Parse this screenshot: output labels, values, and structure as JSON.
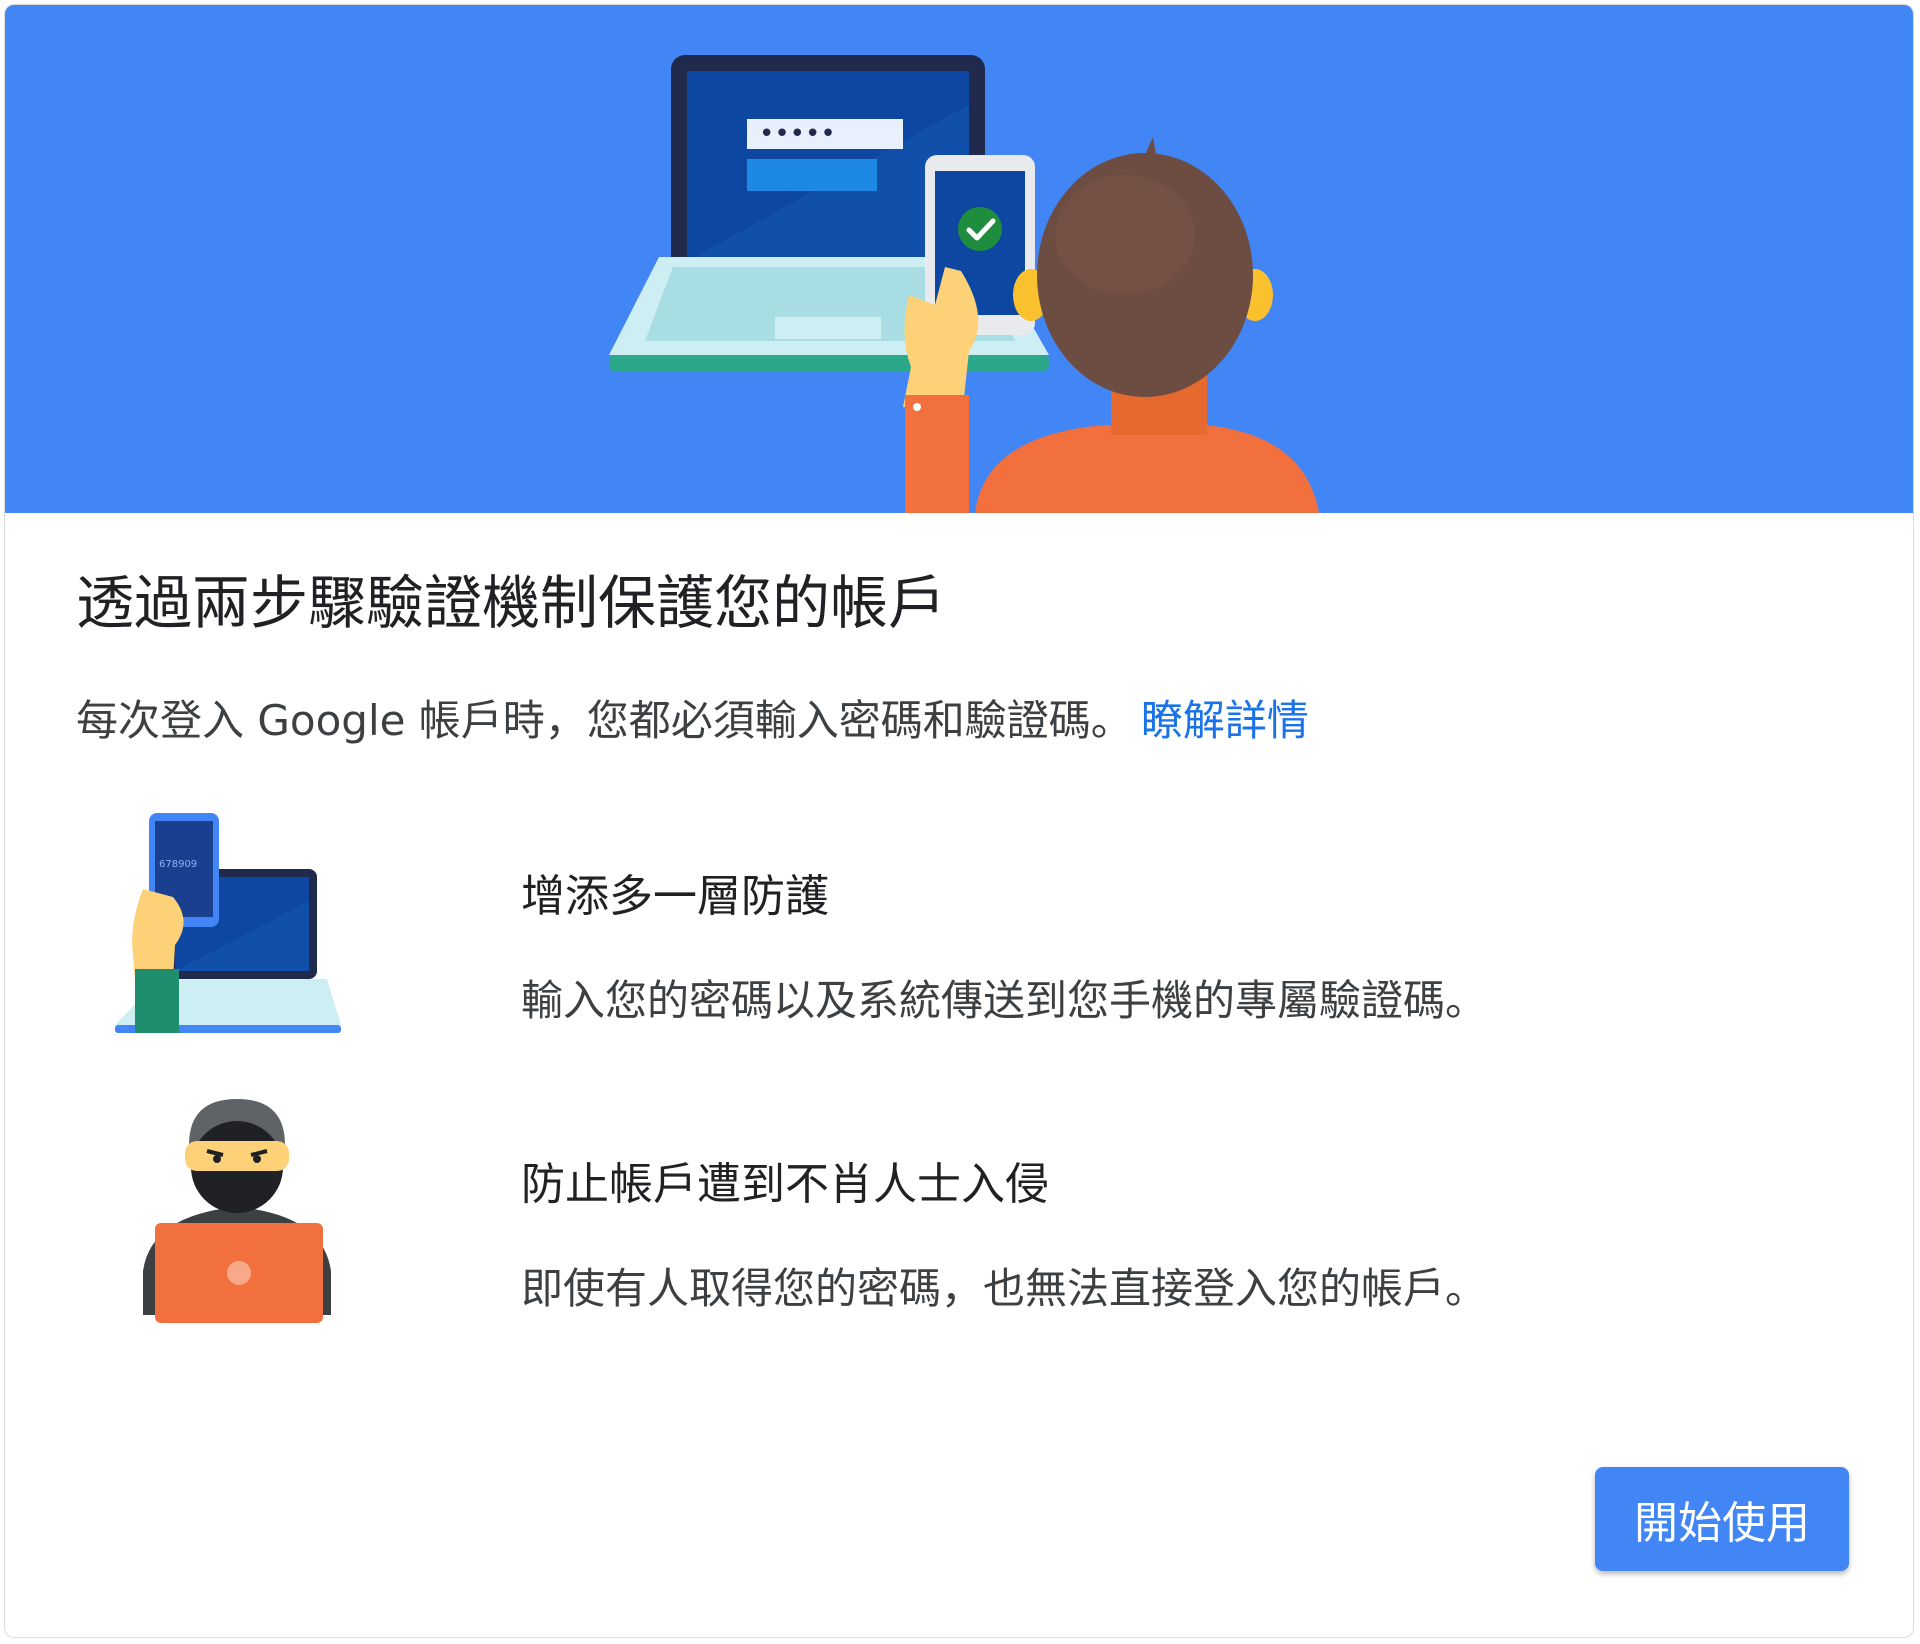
{
  "card": {
    "title": "透過兩步驟驗證機制保護您的帳戶",
    "subtitle": "每次登入 Google 帳戶時，您都必須輸入密碼和驗證碼。",
    "learn_more": "瞭解詳情"
  },
  "hero": {
    "password_mask": "•••••"
  },
  "features": [
    {
      "heading": "增添多一層防護",
      "description": "輸入您的密碼以及系統傳送到您手機的專屬驗證碼。",
      "icon": "phone-laptop-icon",
      "phone_code": "678909"
    },
    {
      "heading": "防止帳戶遭到不肖人士入侵",
      "description": "即使有人取得您的密碼，也無法直接登入您的帳戶。",
      "icon": "hacker-icon"
    }
  ],
  "actions": {
    "start_label": "開始使用"
  },
  "colors": {
    "hero_background": "#4285f4",
    "button_background": "#4285f4",
    "link": "#1a73e8"
  }
}
